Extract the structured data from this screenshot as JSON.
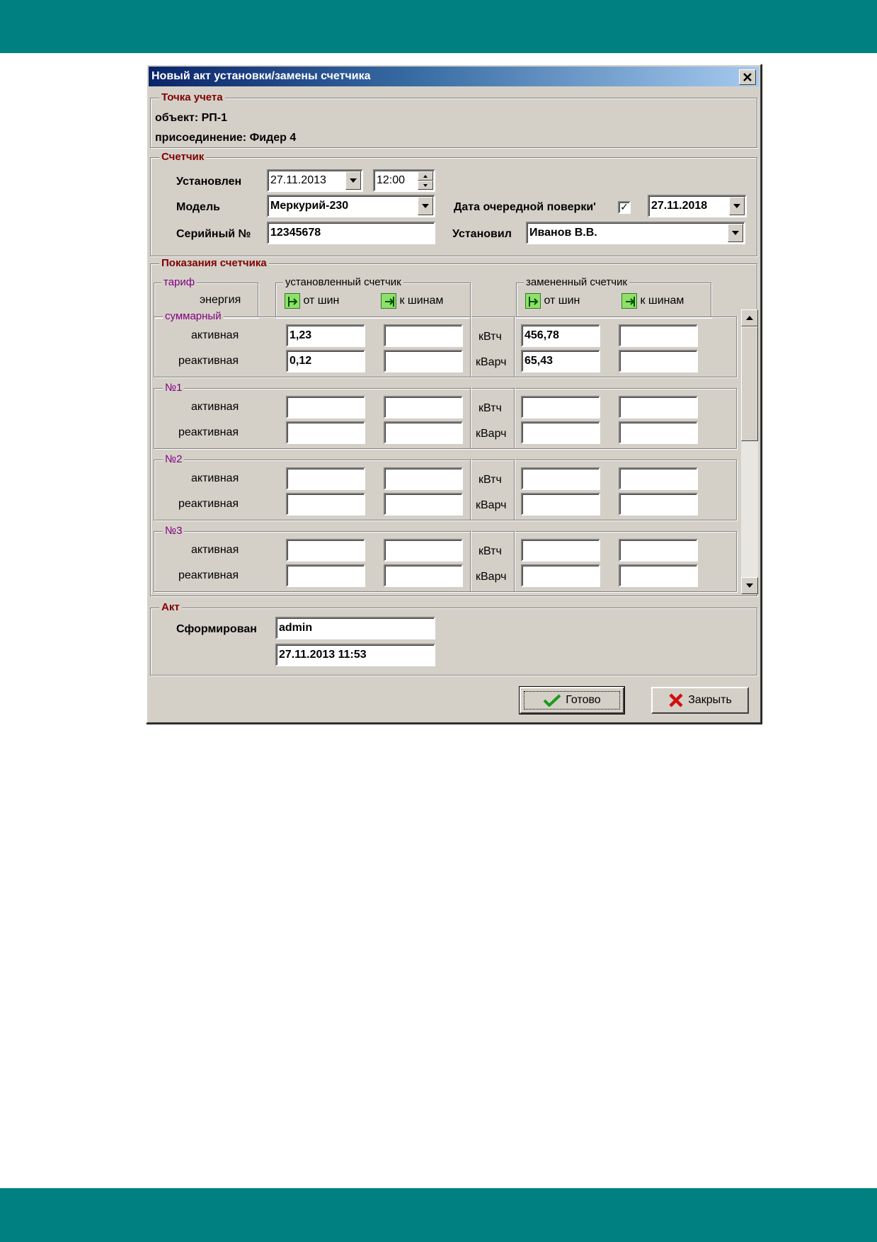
{
  "dialog": {
    "title": "Новый акт установки/замены счетчика"
  },
  "point": {
    "legend": "Точка учета",
    "object_line": "объект: РП-1",
    "connection_line": "присоединение: Фидер 4"
  },
  "meter": {
    "legend": "Счетчик",
    "installed_label": "Установлен",
    "installed_date": "27.11.2013",
    "installed_time": "12:00",
    "model_label": "Модель",
    "model_value": "Меркурий-230",
    "serial_label": "Серийный №",
    "serial_value": "12345678",
    "next_check_label": "Дата очередной поверки'",
    "next_check_checked": "✓",
    "next_check_date": "27.11.2018",
    "installer_label": "Установил",
    "installer_value": "Иванов В.В."
  },
  "readings": {
    "legend": "Показания счетчика",
    "header": {
      "tariff_legend": "тариф",
      "energy_label": "энергия",
      "installed_legend": "установленный счетчик",
      "replaced_legend": "замененный счетчик",
      "from_bus": "от шин",
      "to_bus": "к шинам"
    },
    "groups": [
      {
        "name": "суммарный",
        "rows": [
          {
            "label": "активная",
            "inst_from": "1,23",
            "inst_to": "",
            "unit": "кВтч",
            "repl_from": "456,78",
            "repl_to": ""
          },
          {
            "label": "реактивная",
            "inst_from": "0,12",
            "inst_to": "",
            "unit": "кВарч",
            "repl_from": "65,43",
            "repl_to": ""
          }
        ]
      },
      {
        "name": "№1",
        "rows": [
          {
            "label": "активная",
            "inst_from": "",
            "inst_to": "",
            "unit": "кВтч",
            "repl_from": "",
            "repl_to": ""
          },
          {
            "label": "реактивная",
            "inst_from": "",
            "inst_to": "",
            "unit": "кВарч",
            "repl_from": "",
            "repl_to": ""
          }
        ]
      },
      {
        "name": "№2",
        "rows": [
          {
            "label": "активная",
            "inst_from": "",
            "inst_to": "",
            "unit": "кВтч",
            "repl_from": "",
            "repl_to": ""
          },
          {
            "label": "реактивная",
            "inst_from": "",
            "inst_to": "",
            "unit": "кВарч",
            "repl_from": "",
            "repl_to": ""
          }
        ]
      },
      {
        "name": "№3",
        "rows": [
          {
            "label": "активная",
            "inst_from": "",
            "inst_to": "",
            "unit": "кВтч",
            "repl_from": "",
            "repl_to": ""
          },
          {
            "label": "реактивная",
            "inst_from": "",
            "inst_to": "",
            "unit": "кВарч",
            "repl_from": "",
            "repl_to": ""
          }
        ]
      }
    ]
  },
  "act": {
    "legend": "Акт",
    "formed_label": "Сформирован",
    "formed_by": "admin",
    "formed_at": "27.11.2013 11:53"
  },
  "buttons": {
    "ok_label": "Готово",
    "close_label": "Закрыть"
  },
  "colors": {
    "band": "#008080",
    "dialog_bg": "#d4d0c8",
    "legend_red": "#800000",
    "legend_purple": "#800080"
  },
  "icons": {
    "ok": "checkmark-icon",
    "close": "red-x-icon",
    "from_bus": "from-bus-icon",
    "to_bus": "to-bus-icon"
  }
}
